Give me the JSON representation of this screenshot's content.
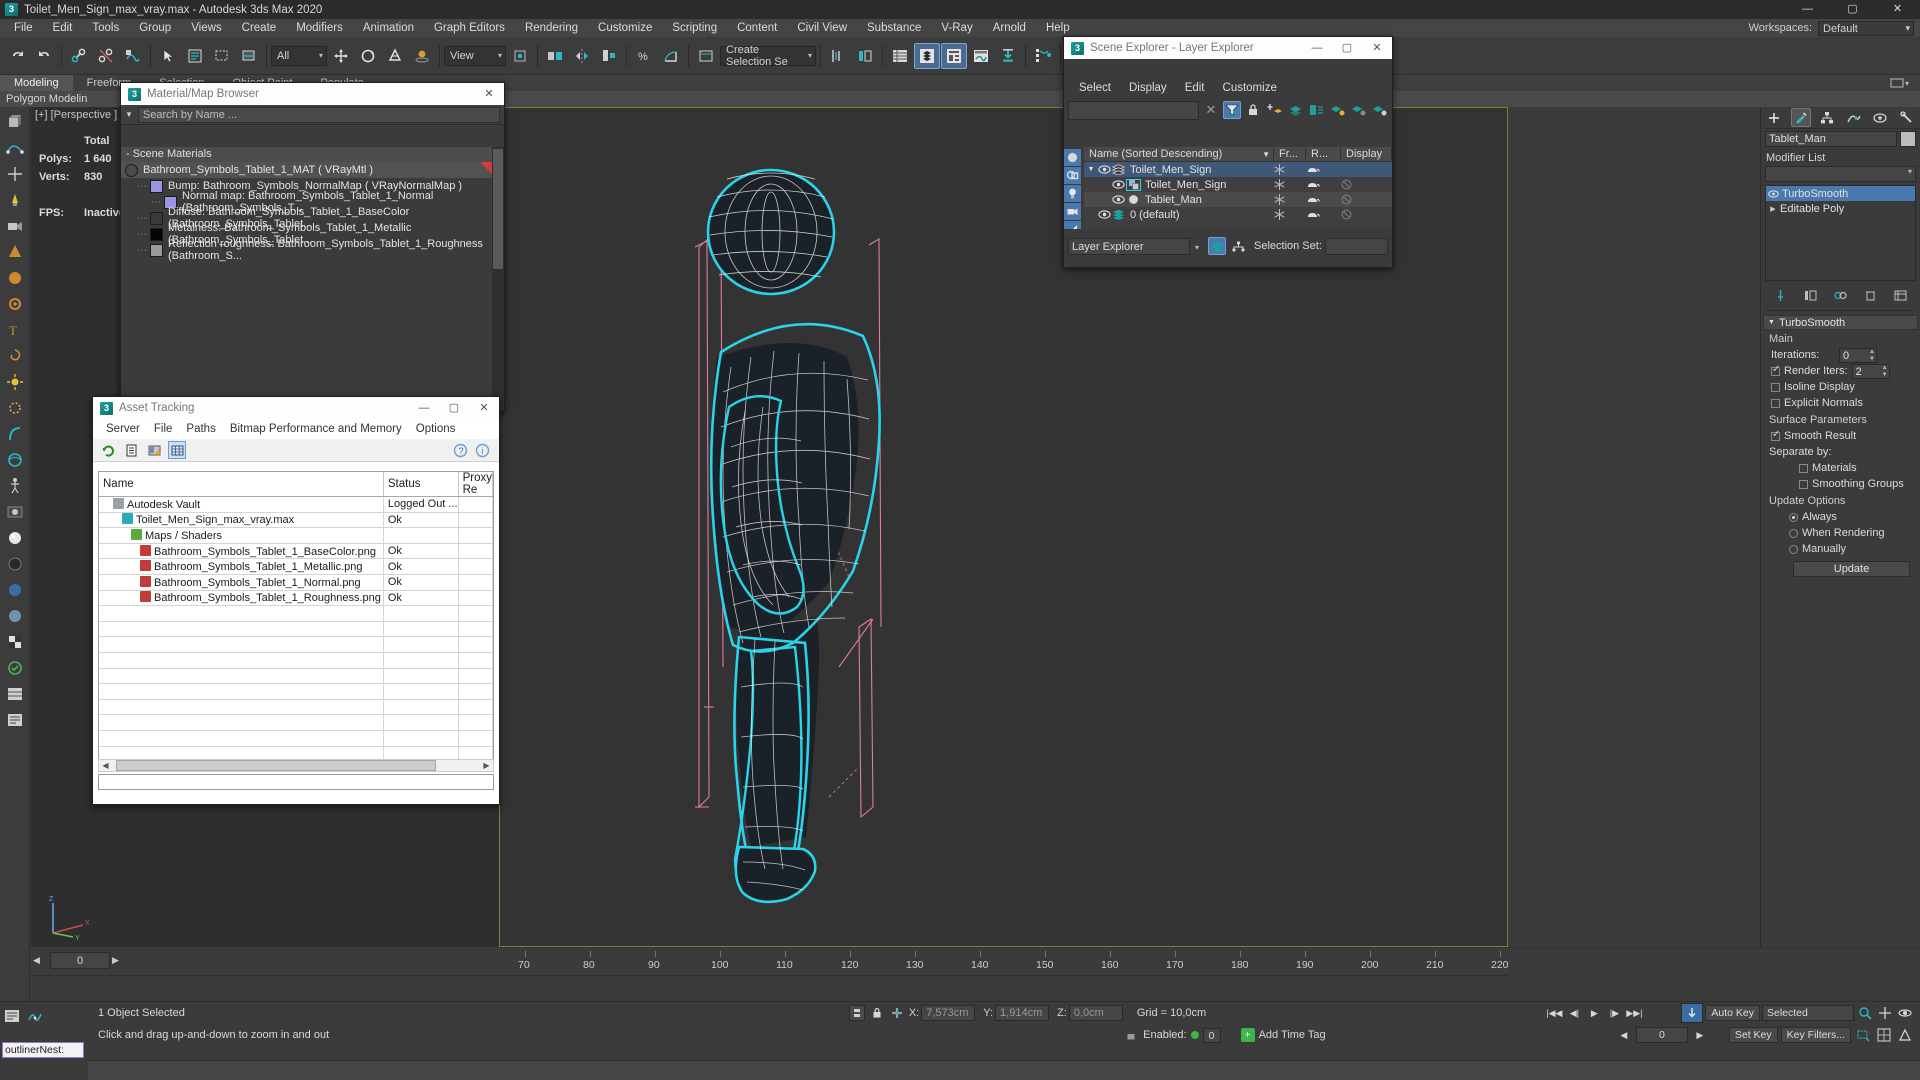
{
  "window": {
    "title": "Toilet_Men_Sign_max_vray.max - Autodesk 3ds Max 2020",
    "app_icon": "3",
    "minimize": "—",
    "maximize": "▢",
    "close": "✕"
  },
  "menubar": {
    "items": [
      "File",
      "Edit",
      "Tools",
      "Group",
      "Views",
      "Create",
      "Modifiers",
      "Animation",
      "Graph Editors",
      "Rendering",
      "Customize",
      "Scripting",
      "Content",
      "Civil View",
      "Substance",
      "V-Ray",
      "Arnold",
      "Help"
    ],
    "workspaces_label": "Workspaces:",
    "workspaces_value": "Default"
  },
  "toolbar": {
    "selection_filter": "All",
    "view_coord": "View",
    "named_selection": "Create Selection Se",
    "icons": [
      "undo-icon",
      "redo-icon",
      "select-link-icon",
      "unlink-icon",
      "bind-space-warp-icon",
      "select-object-icon",
      "select-by-name-icon",
      "select-region-icon",
      "window-crossing-icon",
      "select-move-icon",
      "select-rotate-icon",
      "select-scale-icon",
      "placement-icon",
      "ref-coord-icon",
      "use-pivot-icon",
      "select-similar-icon",
      "mirror-icon",
      "align-icon",
      "layer-explorer-icon",
      "curve-editor-icon",
      "schematic-view-icon",
      "material-editor-icon",
      "render-setup-icon",
      "render-frame-icon",
      "render-production-icon"
    ]
  },
  "ribbon": {
    "tabs": [
      "Modeling",
      "Freeform",
      "Selection",
      "Object Paint",
      "Populate"
    ],
    "active_tab": "Modeling",
    "polygon_modeling": "Polygon Modelin",
    "more": "▾"
  },
  "viewport": {
    "label": "[+] [Perspective ] [ S",
    "stats": [
      {
        "label": "",
        "value": "Total"
      },
      {
        "label": "Polys:",
        "value": "1 640"
      },
      {
        "label": "Verts:",
        "value": "830"
      },
      {
        "label": "FPS:",
        "value": "Inactive"
      }
    ]
  },
  "material_browser": {
    "title": "Material/Map Browser",
    "icon": "3",
    "search_placeholder": "Search by Name ...",
    "group_header": "- Scene Materials",
    "rows": [
      {
        "label": "Bathroom_Symbols_Tablet_1_MAT  ( VRayMtl )",
        "swatch": "#4a4a48",
        "indent": 0,
        "selected": true,
        "sphere": true
      },
      {
        "label": "Bump: Bathroom_Symbols_NormalMap  ( VRayNormalMap )",
        "swatch": "#9a95e0",
        "indent": 1,
        "selected": false
      },
      {
        "label": "Normal map: Bathroom_Symbols_Tablet_1_Normal (Bathroom_Symbols_T...",
        "swatch": "#9a95e0",
        "indent": 2,
        "selected": false
      },
      {
        "label": "Diffuse: Bathroom_Symbols_Tablet_1_BaseColor (Bathroom_Symbols_Tablet...",
        "swatch": "#3a3a3d",
        "indent": 1,
        "selected": false
      },
      {
        "label": "Metalness: Bathroom_Symbols_Tablet_1_Metallic (Bathroom_Symbols_Tablet...",
        "swatch": "#050505",
        "indent": 1,
        "selected": false
      },
      {
        "label": "Reflection roughness: Bathroom_Symbols_Tablet_1_Roughness (Bathroom_S...",
        "swatch": "#9b9b9b",
        "indent": 1,
        "selected": false
      }
    ]
  },
  "asset_tracking": {
    "title": "Asset Tracking",
    "icon": "3",
    "menu": [
      "Server",
      "File",
      "Paths",
      "Bitmap Performance and Memory",
      "Options"
    ],
    "toolbar_icons": [
      "refresh-icon",
      "list-view-icon",
      "path-editor-icon",
      "grid-view-icon",
      "help-icon",
      "info-icon"
    ],
    "columns": [
      "Name",
      "Status",
      "Proxy Re"
    ],
    "rows": [
      {
        "name": "Autodesk Vault",
        "status": "Logged Out ...",
        "proxy": "",
        "indent": 1,
        "icon": "vault-icon",
        "icon_color": "#9aa0a6"
      },
      {
        "name": "Toilet_Men_Sign_max_vray.max",
        "status": "Ok",
        "proxy": "",
        "indent": 2,
        "icon": "max-file-icon",
        "icon_color": "#2aa9b8"
      },
      {
        "name": "Maps / Shaders",
        "status": "",
        "proxy": "",
        "indent": 3,
        "icon": "maps-folder-icon",
        "icon_color": "#5fa83c"
      },
      {
        "name": "Bathroom_Symbols_Tablet_1_BaseColor.png",
        "status": "Ok",
        "proxy": "",
        "indent": 4,
        "icon": "png-icon",
        "icon_color": "#c23b3b"
      },
      {
        "name": "Bathroom_Symbols_Tablet_1_Metallic.png",
        "status": "Ok",
        "proxy": "",
        "indent": 4,
        "icon": "png-icon",
        "icon_color": "#c23b3b"
      },
      {
        "name": "Bathroom_Symbols_Tablet_1_Normal.png",
        "status": "Ok",
        "proxy": "",
        "indent": 4,
        "icon": "png-icon",
        "icon_color": "#c23b3b"
      },
      {
        "name": "Bathroom_Symbols_Tablet_1_Roughness.png",
        "status": "Ok",
        "proxy": "",
        "indent": 4,
        "icon": "png-icon",
        "icon_color": "#c23b3b"
      }
    ],
    "empty_rows": 13
  },
  "scene_explorer": {
    "title": "Scene Explorer - Layer Explorer",
    "icon": "3",
    "menu": [
      "Select",
      "Display",
      "Edit",
      "Customize"
    ],
    "search_value": "",
    "clear_icon": "✕",
    "columns": [
      "Name (Sorted Descending)",
      "Fr...",
      "R...",
      "Display as Box"
    ],
    "rows": [
      {
        "name": "Toilet_Men_Sign",
        "indent": 0,
        "selected": true,
        "type_icon": "layer-icon",
        "expander": "▼",
        "frozen": "snowflake-icon",
        "render": "teapot-icon",
        "box": ""
      },
      {
        "name": "Toilet_Men_Sign",
        "indent": 1,
        "selected": false,
        "type_icon": "object-icon-highlighted",
        "expander": "",
        "frozen": "snowflake-icon",
        "render": "teapot-icon",
        "box": "disabled-icon"
      },
      {
        "name": "Tablet_Man",
        "indent": 1,
        "selected": false,
        "alt": true,
        "type_icon": "sphere-icon",
        "expander": "",
        "frozen": "snowflake-icon",
        "render": "teapot-icon",
        "box": "disabled-icon"
      },
      {
        "name": "0 (default)",
        "indent": 0,
        "selected": false,
        "type_icon": "layer-icon-teal",
        "expander": "",
        "frozen": "snowflake-icon",
        "render": "teapot-icon",
        "box": "disabled-icon"
      }
    ],
    "footer_combo": "Layer Explorer",
    "selection_set_label": "Selection Set:",
    "selection_set_value": ""
  },
  "command_panel": {
    "tabs": [
      "create-tab",
      "modify-tab",
      "hierarchy-tab",
      "motion-tab",
      "display-tab",
      "utilities-tab"
    ],
    "active_tab": "modify-tab",
    "object_name": "Tablet_Man",
    "modifier_list_label": "Modifier List",
    "stack": [
      {
        "label": "TurboSmooth",
        "selected": true,
        "eye": true
      },
      {
        "label": "Editable Poly",
        "selected": false,
        "eye": false,
        "expander": "▶"
      }
    ],
    "rollout": {
      "title": "TurboSmooth",
      "sections": [
        {
          "label": "Main"
        },
        {
          "label": "Surface Parameters"
        },
        {
          "label": "Update Options"
        }
      ],
      "iterations_label": "Iterations:",
      "iterations_value": "0",
      "render_iters_label": "Render Iters:",
      "render_iters_value": "2",
      "render_iters_checked": true,
      "isoline_display": "Isoline Display",
      "isoline_checked": false,
      "explicit_normals": "Explicit Normals",
      "explicit_checked": false,
      "smooth_result": "Smooth Result",
      "smooth_checked": true,
      "separate_by": "Separate by:",
      "materials": "Materials",
      "materials_checked": false,
      "smoothing_groups": "Smoothing Groups",
      "smoothing_checked": false,
      "update_always": "Always",
      "update_when_rendering": "When Rendering",
      "update_manually": "Manually",
      "update_selected": "Always",
      "update_button": "Update"
    }
  },
  "timeline": {
    "frame_value": "0",
    "left_arrow": "◀",
    "right_arrow": "▶",
    "ruler_ticks": [
      "70",
      "80",
      "90",
      "100",
      "110",
      "120",
      "130",
      "140",
      "150",
      "160",
      "170",
      "180",
      "190",
      "200",
      "210",
      "220"
    ]
  },
  "status_bar": {
    "objects_selected": "1 Object Selected",
    "prompt": "Click and drag up-and-down to zoom in and out",
    "coords": [
      {
        "axis": "X:",
        "value": "7,573cm"
      },
      {
        "axis": "Y:",
        "value": "1,914cm"
      },
      {
        "axis": "Z:",
        "value": "0,0cm"
      }
    ],
    "grid_label": "Grid = 10,0cm",
    "add_time_tag": "Add Time Tag",
    "enabled_label": "Enabled:",
    "enabled_value": "0",
    "auto_key": "Auto Key",
    "set_key": "Set Key",
    "selected_dropdown": "Selected",
    "key_filters": "Key Filters...",
    "outliner_label": "outlinerNest:",
    "maxscript_placeholder": ""
  },
  "colors": {
    "accent_blue": "#4a79b0",
    "selection_cyan": "#2ad4e8",
    "gizmo_pink": "#e87fa8",
    "viewport_bg": "#333333",
    "panel_bg": "#3b3b3b",
    "toolbar_bg": "#3c3c3c"
  }
}
